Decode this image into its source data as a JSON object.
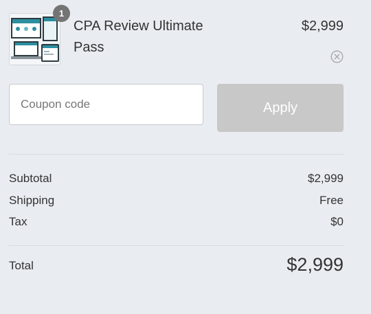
{
  "product": {
    "quantity": "1",
    "name": "CPA Review Ultimate Pass",
    "price": "$2,999"
  },
  "coupon": {
    "placeholder": "Coupon code",
    "value": "",
    "apply_label": "Apply"
  },
  "summary": {
    "subtotal_label": "Subtotal",
    "subtotal_value": "$2,999",
    "shipping_label": "Shipping",
    "shipping_value": "Free",
    "tax_label": "Tax",
    "tax_value": "$0",
    "total_label": "Total",
    "total_value": "$2,999"
  },
  "colors": {
    "background": "#e9ecf1",
    "badge": "#747474",
    "apply_disabled": "#c8c8c8",
    "thumb_accent": "#2c8fa0"
  },
  "icons": {
    "remove": "close-circle-icon"
  }
}
